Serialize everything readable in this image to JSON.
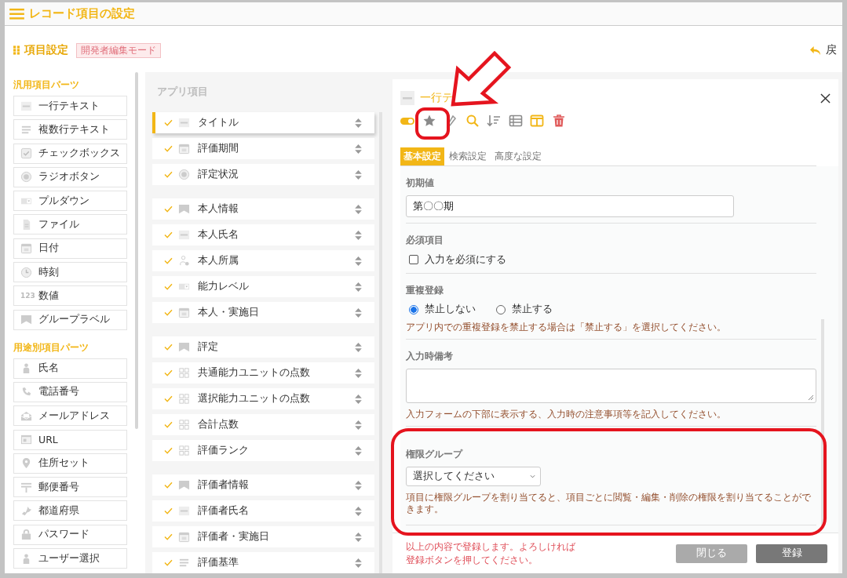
{
  "header": {
    "title": "レコード項目の設定"
  },
  "page": {
    "title": "項目設定",
    "badge": "開発者編集モード",
    "back_label": "戻"
  },
  "palette": [
    {
      "heading": "汎用項目パーツ",
      "items": [
        {
          "label": "一行テキスト",
          "kind": "line"
        },
        {
          "label": "複数行テキスト",
          "kind": "multiline"
        },
        {
          "label": "チェックボックス",
          "kind": "checkbox"
        },
        {
          "label": "ラジオボタン",
          "kind": "radio"
        },
        {
          "label": "プルダウン",
          "kind": "dropdown"
        },
        {
          "label": "ファイル",
          "kind": "file"
        },
        {
          "label": "日付",
          "kind": "date"
        },
        {
          "label": "時刻",
          "kind": "time"
        },
        {
          "label": "数値",
          "kind": "number",
          "icon_text": "123"
        },
        {
          "label": "グループラベル",
          "kind": "group"
        }
      ]
    },
    {
      "heading": "用途別項目パーツ",
      "items": [
        {
          "label": "氏名",
          "kind": "person"
        },
        {
          "label": "電話番号",
          "kind": "phone"
        },
        {
          "label": "メールアドレス",
          "kind": "mail"
        },
        {
          "label": "URL",
          "kind": "url"
        },
        {
          "label": "住所セット",
          "kind": "pin"
        },
        {
          "label": "郵便番号",
          "kind": "postal"
        },
        {
          "label": "都道府県",
          "kind": "prefecture"
        },
        {
          "label": "パスワード",
          "kind": "lock"
        },
        {
          "label": "ユーザー選択",
          "kind": "user"
        }
      ]
    }
  ],
  "app_items": {
    "title": "アプリ項目",
    "groups": [
      {
        "items": [
          {
            "label": "タイトル",
            "kind": "line",
            "selected": true
          },
          {
            "label": "評価期間",
            "kind": "date",
            "selected": false
          },
          {
            "label": "評定状況",
            "kind": "radio",
            "selected": false
          }
        ]
      },
      {
        "items": [
          {
            "label": "本人情報",
            "kind": "group",
            "selected": false
          },
          {
            "label": "本人氏名",
            "kind": "line",
            "selected": false
          },
          {
            "label": "本人所属",
            "kind": "org",
            "selected": false
          },
          {
            "label": "能力レベル",
            "kind": "dropdown",
            "selected": false
          },
          {
            "label": "本人・実施日",
            "kind": "date",
            "selected": false
          }
        ]
      },
      {
        "items": [
          {
            "label": "評定",
            "kind": "group",
            "selected": false
          },
          {
            "label": "共通能力ユニットの点数",
            "kind": "grid",
            "selected": false
          },
          {
            "label": "選択能力ユニットの点数",
            "kind": "grid",
            "selected": false
          },
          {
            "label": "合計点数",
            "kind": "grid",
            "selected": false
          },
          {
            "label": "評価ランク",
            "kind": "grid",
            "selected": false
          }
        ]
      },
      {
        "items": [
          {
            "label": "評価者情報",
            "kind": "group",
            "selected": false
          },
          {
            "label": "評価者氏名",
            "kind": "line",
            "selected": false
          },
          {
            "label": "評価者・実施日",
            "kind": "date",
            "selected": false
          },
          {
            "label": "評価基準",
            "kind": "multiline",
            "selected": false
          }
        ]
      }
    ]
  },
  "editor": {
    "field_type": "一行テ",
    "tools": [
      {
        "kind": "toggle"
      },
      {
        "kind": "star"
      },
      {
        "kind": "pen"
      },
      {
        "kind": "search"
      },
      {
        "kind": "sort"
      },
      {
        "kind": "list"
      },
      {
        "kind": "columns"
      },
      {
        "kind": "trash"
      }
    ],
    "tabs": [
      {
        "label": "基本設定",
        "selected": true
      },
      {
        "label": "検索設定",
        "selected": false
      },
      {
        "label": "高度な設定",
        "selected": false
      }
    ],
    "sections": [
      {
        "kind": "text",
        "label": "初期値",
        "value": "第〇〇期"
      },
      {
        "kind": "checkbox",
        "label": "必須項目",
        "option": "入力を必須にする",
        "checked": false
      },
      {
        "kind": "radio",
        "label": "重複登録",
        "options": [
          {
            "label": "禁止しない",
            "selected": true
          },
          {
            "label": "禁止する",
            "selected": false
          }
        ],
        "note": "アプリ内での重複登録を禁止する場合は「禁止する」を選択してください。"
      },
      {
        "kind": "textarea",
        "label": "入力時備考",
        "note": "入力フォームの下部に表示する、入力時の注意事項等を記入してください。"
      },
      {
        "kind": "select",
        "label": "権限グループ",
        "value": "選択してください",
        "note": "項目に権限グループを割り当てると、項目ごとに閲覧・編集・削除の権限を割り当てることができます。"
      }
    ],
    "footer_message": "以上の内容で登録します。よろしければ登録ボタンを押してください。",
    "buttons": [
      {
        "label": "閉じる",
        "kind": "secondary"
      },
      {
        "label": "登録",
        "kind": "primary"
      }
    ]
  }
}
